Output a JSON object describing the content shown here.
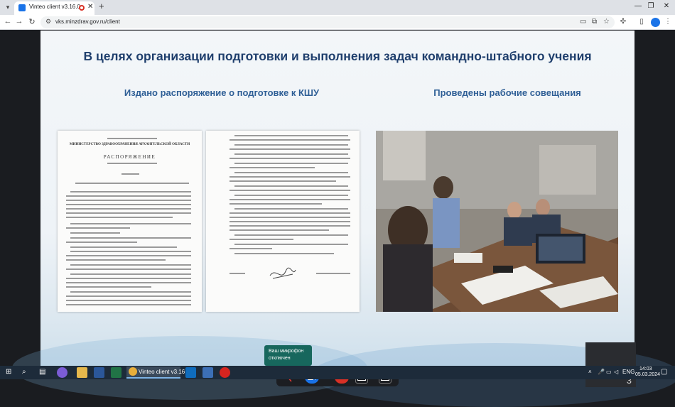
{
  "browser": {
    "tab_title": "Vinteo client v3.16.0",
    "url": "vks.minzdrav.gov.ru/client",
    "new_tab_label": "+",
    "tab_close_label": "✕"
  },
  "slide": {
    "title": "В целях организации подготовки и выполнения задач командно-штабного учения",
    "subtitle_left": "Издано распоряжение о подготовке к КШУ",
    "subtitle_right": "Проведены рабочие совещания",
    "document": {
      "ministry": "МИНИСТЕРСТВО ЗДРАВООХРАНЕНИЯ АРХАНГЕЛЬСКОЙ ОБЛАСТИ",
      "doc_type": "РАСПОРЯЖЕНИЕ"
    }
  },
  "toast": {
    "text": "Ваш микрофон отключен"
  },
  "participants": {
    "count": "3"
  },
  "taskbar": {
    "chrome_label": "Vinteo client v3.16...",
    "language": "ENG",
    "time": "14:03",
    "date": "05.03.2024"
  },
  "colors": {
    "title": "#1f3f6d",
    "subtitle": "#2f5f96",
    "toast_bg": "#17675d",
    "hangup": "#d93025",
    "camera_active": "#1a73e8"
  }
}
